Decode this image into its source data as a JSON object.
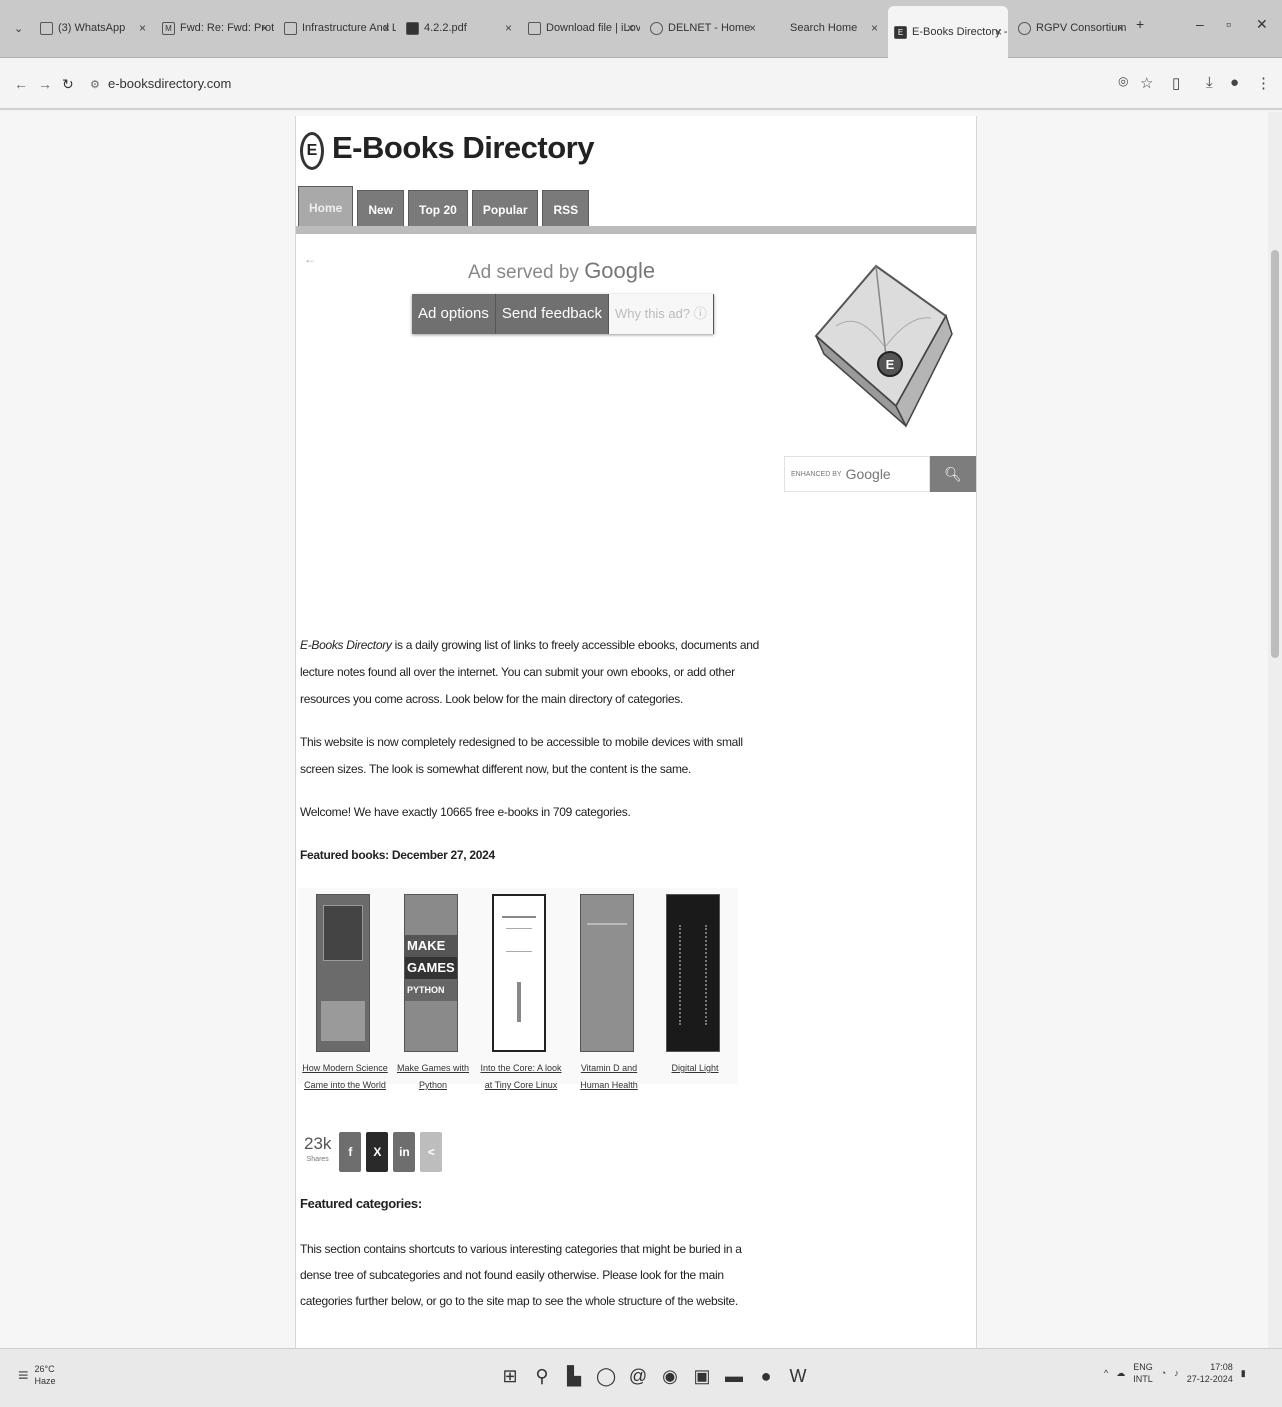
{
  "browser": {
    "tabs": [
      {
        "label": "(3) WhatsApp",
        "icon": "whatsapp-icon",
        "active": false
      },
      {
        "label": "Fwd: Re: Fwd: Proto",
        "icon": "gmail-icon",
        "active": false
      },
      {
        "label": "Infrastructure And Li",
        "icon": "doc-icon",
        "active": false
      },
      {
        "label": "4.2.2.pdf",
        "icon": "pdf-icon",
        "active": false
      },
      {
        "label": "Download file | iLove",
        "icon": "download-icon",
        "active": false
      },
      {
        "label": "DELNET - Home",
        "icon": "globe-icon",
        "active": false
      },
      {
        "label": "Search Home",
        "icon": "search-icon",
        "active": false
      },
      {
        "label": "E-Books Directory - ",
        "icon": "ebook-icon",
        "active": true
      },
      {
        "label": "RGPV Consortium a",
        "icon": "globe-icon",
        "active": false
      }
    ],
    "url": "e-booksdirectory.com"
  },
  "site": {
    "title": "E-Books Directory",
    "logo_letter": "E",
    "nav": [
      "Home",
      "New",
      "Top 20",
      "Popular",
      "RSS"
    ]
  },
  "ad": {
    "served_prefix": "Ad served by",
    "served_brand": "Google",
    "buttons": [
      "Ad options",
      "Send feedback",
      "Why this ad? ⓘ"
    ]
  },
  "search": {
    "enhanced_label": "ENHANCED BY",
    "brand": "Google"
  },
  "intro": {
    "p1_em": "E-Books Directory",
    "p1_rest": " is a daily growing list of links to freely accessible ebooks, documents and lecture notes found all over the internet. You can submit your own ebooks, or add other resources you come across. Look below for the main directory of categories.",
    "p2": "This website is now completely redesigned to be accessible to mobile devices with small screen sizes. The look is somewhat different now, but the content is the same.",
    "p3": "Welcome! We have exactly 10665 free e-books in 709 categories.",
    "featured_heading": "Featured books: December 27, 2024"
  },
  "featured_books": [
    {
      "title": "How Modern Science Came into the World",
      "cover_color": "#6b6b6b"
    },
    {
      "title": "Make Games with Python",
      "cover_color": "#8a8a8a"
    },
    {
      "title": "Into the Core: A look at Tiny Core Linux",
      "cover_color": "#ffffff"
    },
    {
      "title": "Vitamin D and Human Health",
      "cover_color": "#8f8f8f"
    },
    {
      "title": "Digital Light",
      "cover_color": "#1a1a1a"
    }
  ],
  "shares": {
    "count": "23k",
    "label": "Shares",
    "buttons": [
      "f",
      "X",
      "in",
      "<"
    ]
  },
  "featured_categories": {
    "heading": "Featured categories:",
    "text": "This section contains shortcuts to various interesting categories that might be buried in a dense tree of subcategories and not found easily otherwise. Please look for the main categories further below, or go to the site map to see the whole structure of the website."
  },
  "taskbar": {
    "weather_temp": "26°C",
    "weather_desc": "Haze",
    "lang_top": "ENG",
    "lang_bottom": "INTL",
    "time": "17:08",
    "date": "27-12-2024"
  }
}
